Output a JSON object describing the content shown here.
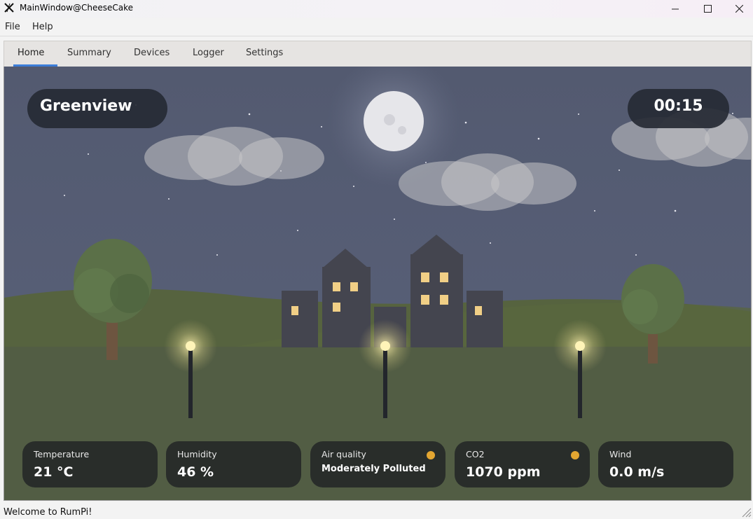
{
  "window": {
    "title": "MainWindow@CheeseCake",
    "icon": "x-logo-icon"
  },
  "menubar": {
    "items": [
      {
        "label": "File"
      },
      {
        "label": "Help"
      }
    ]
  },
  "tabs": [
    {
      "label": "Home",
      "active": true
    },
    {
      "label": "Summary",
      "active": false
    },
    {
      "label": "Devices",
      "active": false
    },
    {
      "label": "Logger",
      "active": false
    },
    {
      "label": "Settings",
      "active": false
    }
  ],
  "home": {
    "location": "Greenview",
    "clock": "00:15",
    "cards": [
      {
        "label": "Temperature",
        "value": "21 °C",
        "indicator": null
      },
      {
        "label": "Humidity",
        "value": "46 %",
        "indicator": null
      },
      {
        "label": "Air quality",
        "value": "Moderately Polluted",
        "indicator": "#e3a631"
      },
      {
        "label": "CO2",
        "value": "1070 ppm",
        "indicator": "#e3a631"
      },
      {
        "label": "Wind",
        "value": "0.0 m/s",
        "indicator": null
      }
    ]
  },
  "status": {
    "message": "Welcome to RumPi!"
  },
  "colors": {
    "accent": "#3d7ed9",
    "warning_dot": "#e3a631",
    "sky": "#555d72",
    "ground": "#515c43"
  }
}
